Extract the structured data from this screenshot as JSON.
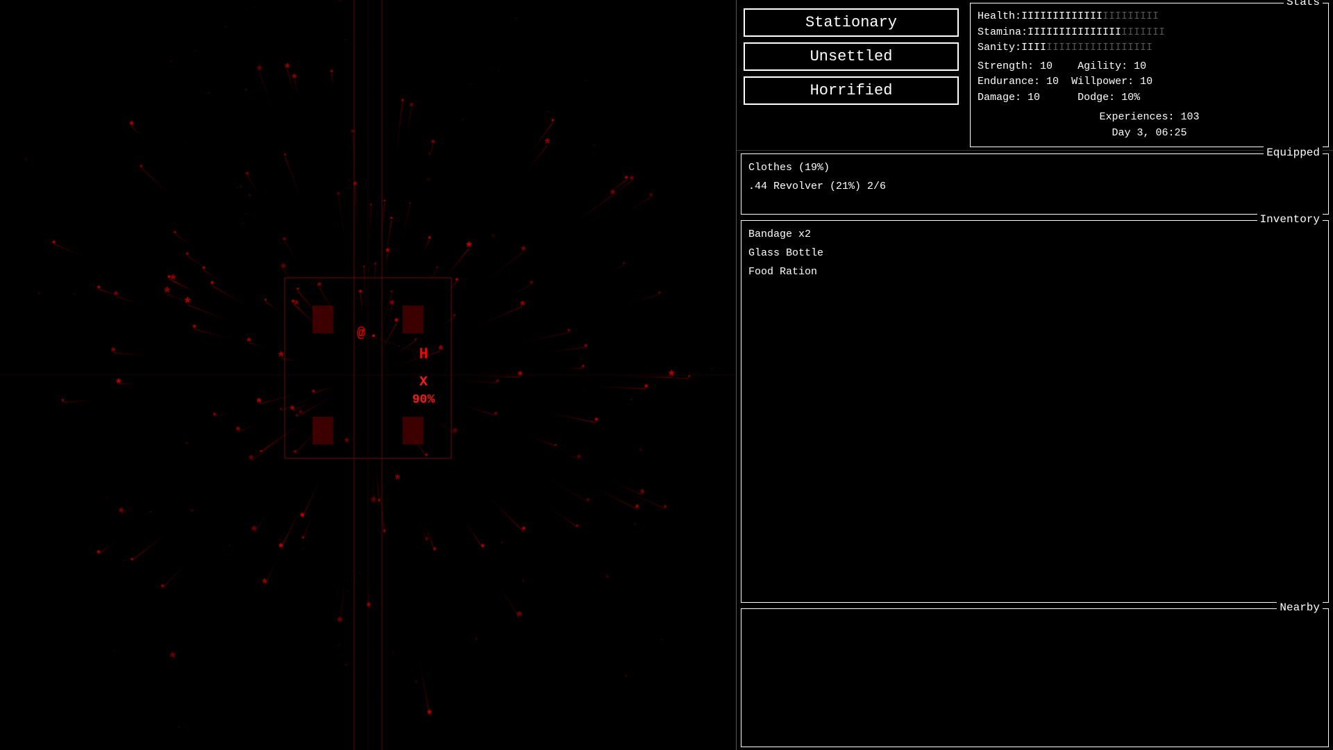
{
  "status_buttons": [
    {
      "id": "stationary",
      "label": "Stationary"
    },
    {
      "id": "unsettled",
      "label": "Unsettled"
    },
    {
      "id": "horrified",
      "label": "Horrified"
    }
  ],
  "stats": {
    "panel_title": "Stats",
    "health_label": "Health:",
    "health_full": "IIIIIIIIIIIII",
    "health_empty": "IIIIIIIII",
    "stamina_label": "Stamina:",
    "stamina_full": "IIIIIIIIIIIIIII",
    "stamina_empty": "IIIIIII",
    "sanity_label": "Sanity:",
    "sanity_full": "IIII",
    "sanity_empty": "IIIIIIIIIIIIIIIII",
    "strength_label": "Strength:",
    "strength_value": "10",
    "agility_label": "Agility:",
    "agility_value": "10",
    "endurance_label": "Endurance:",
    "endurance_value": "10",
    "willpower_label": "Willpower:",
    "willpower_value": "10",
    "damage_label": "Damage:",
    "damage_value": "10",
    "dodge_label": "Dodge:",
    "dodge_value": "10%",
    "experiences_label": "Experiences:",
    "experiences_value": "103",
    "day_label": "Day 3, 06:25"
  },
  "equipped": {
    "panel_title": "Equipped",
    "items": [
      "Clothes (19%)",
      ".44 Revolver (21%) 2/6"
    ]
  },
  "inventory": {
    "panel_title": "Inventory",
    "items": [
      "Bandage x2",
      "Glass Bottle",
      "Food Ration"
    ]
  },
  "nearby": {
    "panel_title": "Nearby",
    "items": []
  },
  "game": {
    "player_symbol": "@",
    "enemy_symbol": "H",
    "crosshair_symbol": "X",
    "hit_percent": "90%"
  }
}
